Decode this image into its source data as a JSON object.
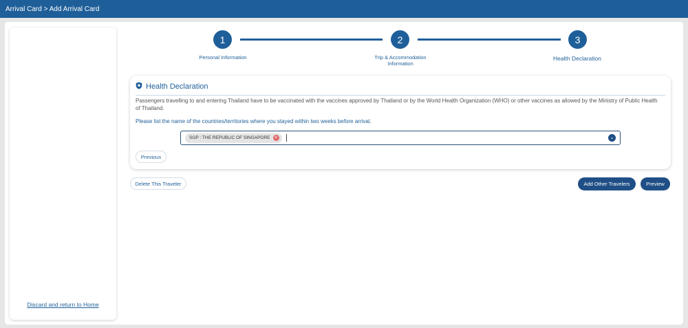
{
  "topbar": {
    "breadcrumb": "Arrival Card > Add Arrival Card"
  },
  "sidebar": {
    "discard_link": "Discard and return to Home"
  },
  "stepper": {
    "steps": [
      {
        "number": "1",
        "label": "Personal Information"
      },
      {
        "number": "2",
        "label": "Trip & Accommodation Information"
      },
      {
        "number": "3",
        "label": "Health Declaration"
      }
    ]
  },
  "health": {
    "title": "Health Declaration",
    "description": "Passengers travelling to and entering Thailand have to be vaccinated with the vaccines approved by Thailand or by the World Health Organization (WHO) or other vaccines as allowed by the Ministry of Public Health of Thailand.",
    "question": "Please list the name of the countries/territories where you stayed within two weeks before arrival.",
    "selected_countries": [
      "SGP : THE REPUBLIC OF SINGAPORE"
    ],
    "previous_label": "Previous"
  },
  "actions": {
    "delete_label": "Delete This Traveler",
    "add_travelers_label": "Add Other Travelers",
    "preview_label": "Preview"
  },
  "colors": {
    "primary": "#1f5f99",
    "chip_remove": "#e06b6b"
  }
}
